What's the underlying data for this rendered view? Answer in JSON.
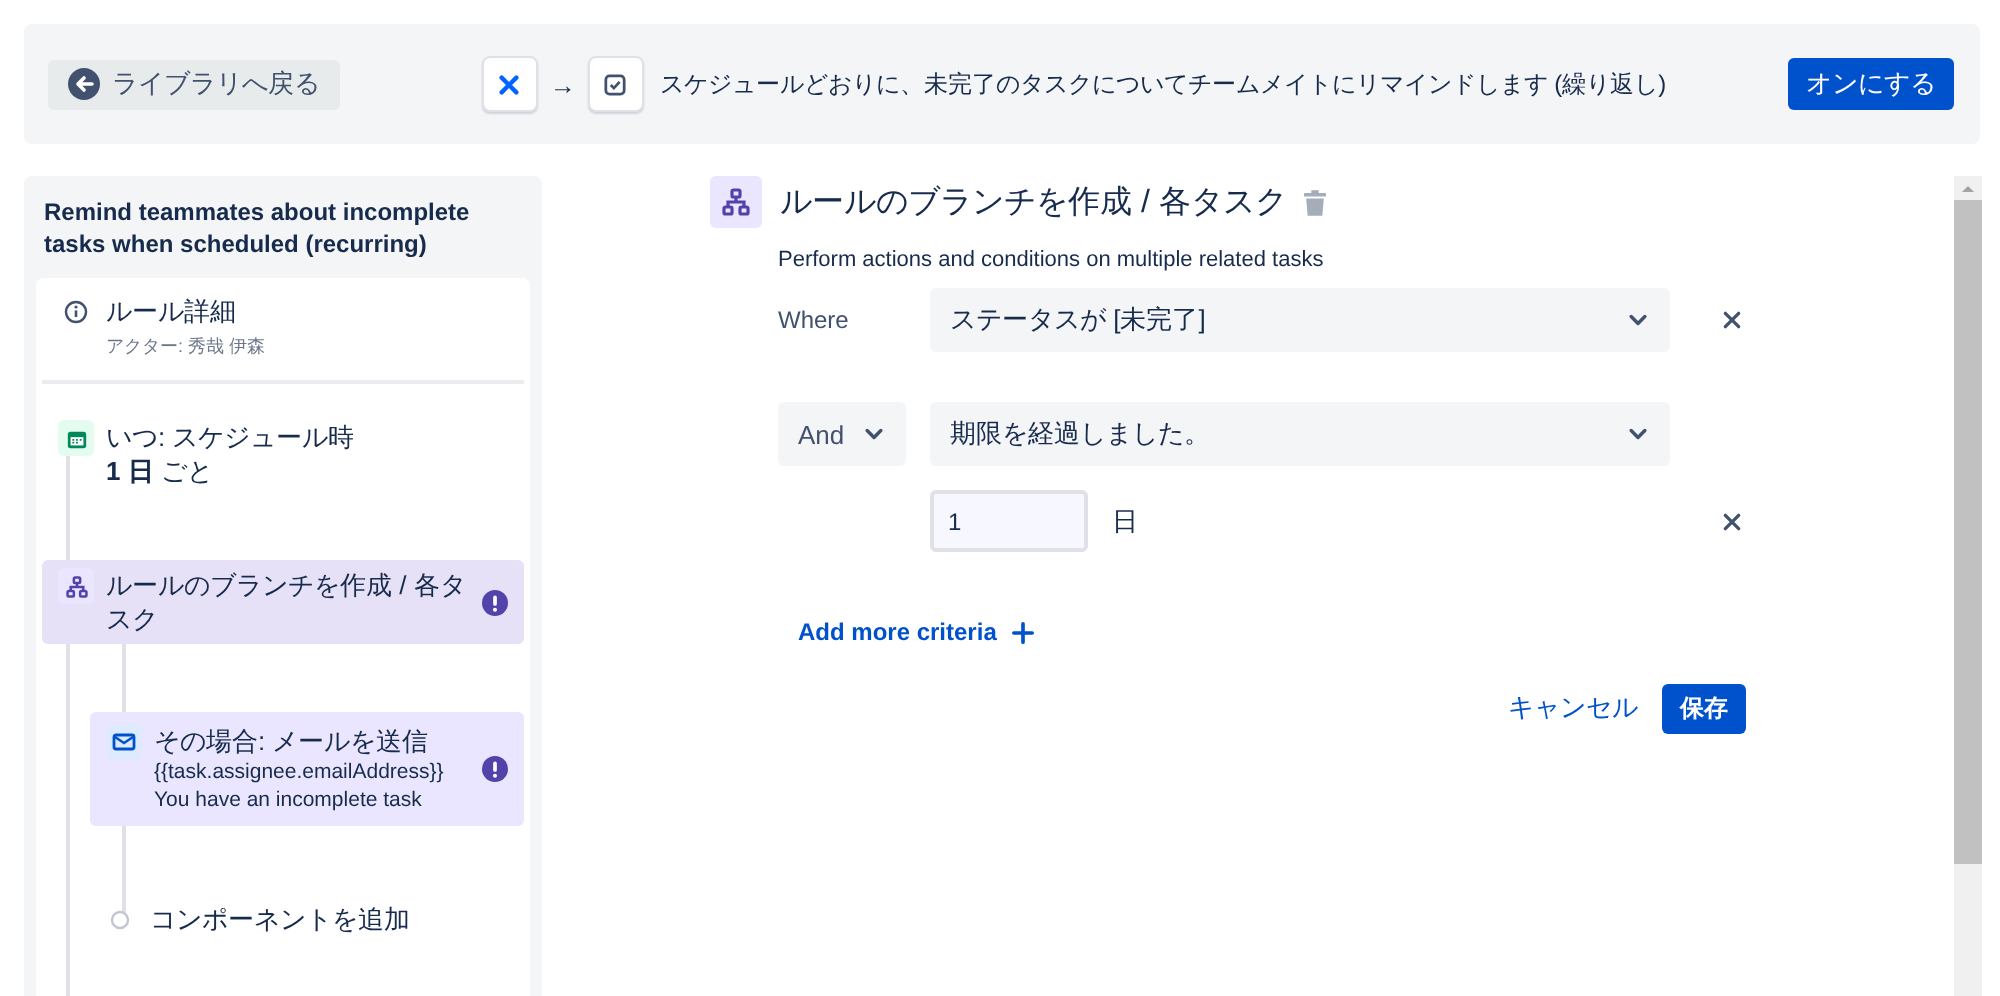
{
  "top_bar": {
    "back_button": "ライブラリへ戻る",
    "flow_arrow": "→",
    "summary": "スケジュールどおりに、未完了のタスクについてチームメイトにリマインドします (繰り返し)",
    "enable_button": "オンにする"
  },
  "sidebar": {
    "title": "Remind teammates about incomplete tasks when scheduled (recurring)",
    "items": [
      {
        "kind": "detail",
        "title": "ルール詳細",
        "subtitle": "アクター: 秀哉 伊森",
        "selected": false
      },
      {
        "kind": "trigger",
        "title": "いつ: スケジュール時",
        "detail": "**1 日** ごと",
        "selected": false
      },
      {
        "kind": "branch",
        "title": "ルールのブランチを作成 / 各タスク",
        "selected": true,
        "warning": true,
        "children": [
          {
            "kind": "action",
            "title": "その場合: メールを送信",
            "lines": [
              "{{task.assignee.emailAddress}}",
              "You have an incomplete task"
            ],
            "selected": false,
            "warning": true
          },
          {
            "kind": "add",
            "title": "コンポーネントを追加"
          }
        ]
      }
    ]
  },
  "editor": {
    "title": "ルールのブランチを作成 / 各タスク",
    "description": "Perform actions and conditions on multiple related tasks",
    "conditions": [
      {
        "kind": "where",
        "label": "Where",
        "value": "ステータスが [未完了]"
      },
      {
        "kind": "and",
        "operator": "And",
        "value": "期限を経過しました。",
        "amount": "1",
        "unit": "日"
      }
    ],
    "add_criteria": "Add more criteria",
    "cancel_button": "キャンセル",
    "save_button": "保存"
  }
}
